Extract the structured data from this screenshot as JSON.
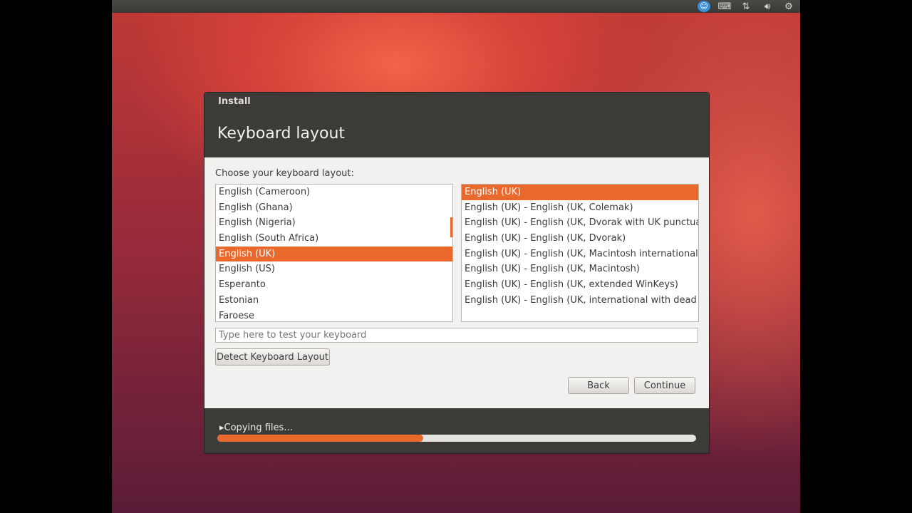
{
  "panel": {
    "icons": [
      "accessibility-icon",
      "keyboard-icon",
      "network-icon",
      "volume-icon",
      "settings-gear-icon"
    ]
  },
  "window": {
    "title": "Install",
    "page_title": "Keyboard layout",
    "prompt": "Choose your keyboard layout:"
  },
  "layouts": [
    "English (Cameroon)",
    "English (Ghana)",
    "English (Nigeria)",
    "English (South Africa)",
    "English (UK)",
    "English (US)",
    "Esperanto",
    "Estonian",
    "Faroese"
  ],
  "layouts_selected": 4,
  "variants": [
    "English (UK)",
    "English (UK) - English (UK, Colemak)",
    "English (UK) - English (UK, Dvorak with UK punctuation)",
    "English (UK) - English (UK, Dvorak)",
    "English (UK) - English (UK, Macintosh international)",
    "English (UK) - English (UK, Macintosh)",
    "English (UK) - English (UK, extended WinKeys)",
    "English (UK) - English (UK, international with dead keys)"
  ],
  "variants_selected": 0,
  "test_input": {
    "value": "",
    "placeholder": "Type here to test your keyboard"
  },
  "buttons": {
    "detect": "Detect Keyboard Layout",
    "back": "Back",
    "continue": "Continue"
  },
  "progress": {
    "label": "Copying files...",
    "percent": 43
  },
  "colors": {
    "accent": "#e9692c",
    "header": "#3c3b37"
  }
}
